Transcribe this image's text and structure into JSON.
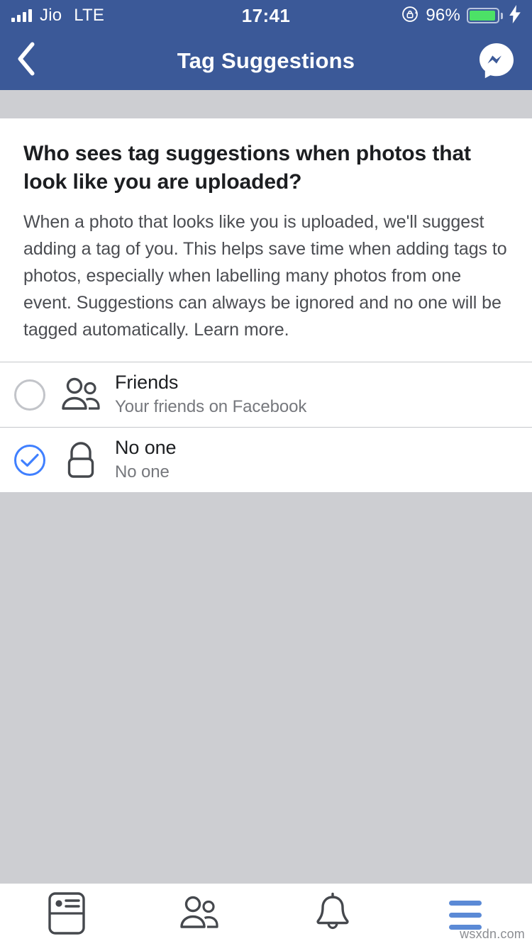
{
  "status_bar": {
    "carrier": "Jio",
    "network": "LTE",
    "time": "17:41",
    "battery_percent": "96%",
    "battery_level": 96,
    "rotation_lock_icon": "rotation-lock-icon",
    "charging_icon": "lightning-bolt-icon",
    "signal_icon": "signal-bars-icon",
    "bars_filled": 4
  },
  "nav_bar": {
    "title": "Tag Suggestions",
    "back_icon": "chevron-left-icon",
    "messenger_icon": "messenger-icon"
  },
  "info": {
    "heading": "Who sees tag suggestions when photos that look like you are uploaded?",
    "body": "When a photo that looks like you is uploaded, we'll suggest adding a tag of you. This helps save time when adding tags to photos, especially when labelling many photos from one event. Suggestions can always be ignored and no one will be tagged automatically. Learn more.",
    "learn_more_label": "Learn more."
  },
  "options": [
    {
      "title": "Friends",
      "subtitle": "Your friends on Facebook",
      "icon": "friends-icon",
      "selected": false
    },
    {
      "title": "No one",
      "subtitle": "No one",
      "icon": "lock-icon",
      "selected": true
    }
  ],
  "tab_bar": {
    "items": [
      {
        "icon": "news-feed-icon",
        "active": false
      },
      {
        "icon": "friends-icon",
        "active": false
      },
      {
        "icon": "notifications-bell-icon",
        "active": false
      },
      {
        "icon": "hamburger-menu-icon",
        "active": true
      }
    ]
  },
  "watermark": "wsxdn.com",
  "colors": {
    "facebook_blue": "#3b5998",
    "accent_blue": "#4080ff",
    "tab_active_blue": "#5b8ad6",
    "background_gray": "#cdced2",
    "battery_green": "#4ce167",
    "text_primary": "#1c1e21",
    "text_secondary": "#76787d"
  }
}
